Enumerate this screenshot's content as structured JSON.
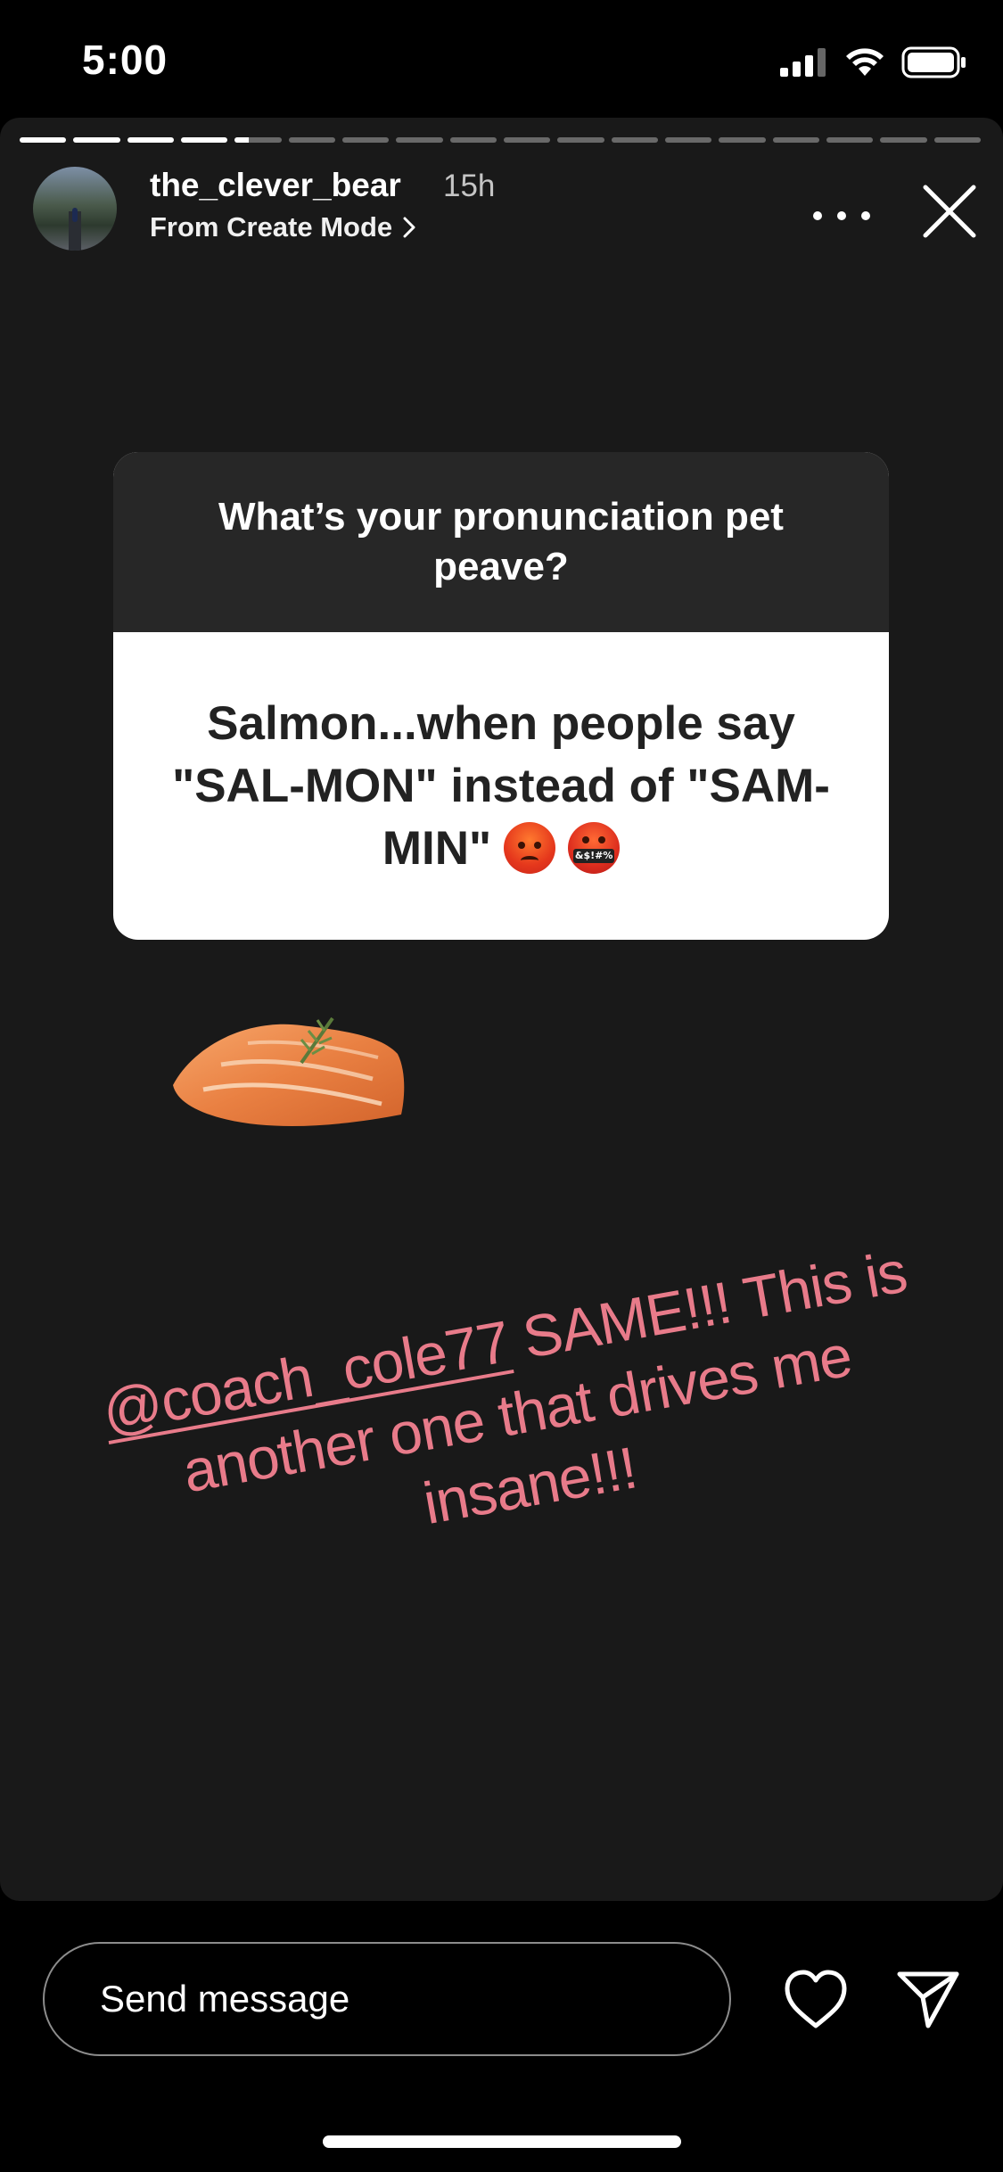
{
  "status_bar": {
    "time": "5:00"
  },
  "story": {
    "segments_total": 18,
    "segments_viewed": 4,
    "current_segment_progress": 0.3,
    "username": "the_clever_bear",
    "time_ago": "15h",
    "subtitle": "From Create Mode",
    "subtitle_chevron": "›",
    "question": "What’s your pronunciation pet peave?",
    "answer": "Salmon...when people say \"SAL-MON\" instead of \"SAM-MIN\"",
    "emoji_1": "angry-face-icon",
    "emoji_2_label": "&$!#%",
    "reply_mention": "@coach_cole77",
    "reply_text": " SAME!!! This is another one that drives me insane!!!"
  },
  "bottom_bar": {
    "message_placeholder": "Send message"
  },
  "colors": {
    "story_bg": "#191919",
    "question_header_bg": "#272727",
    "reply_text": "#e87b8a"
  }
}
